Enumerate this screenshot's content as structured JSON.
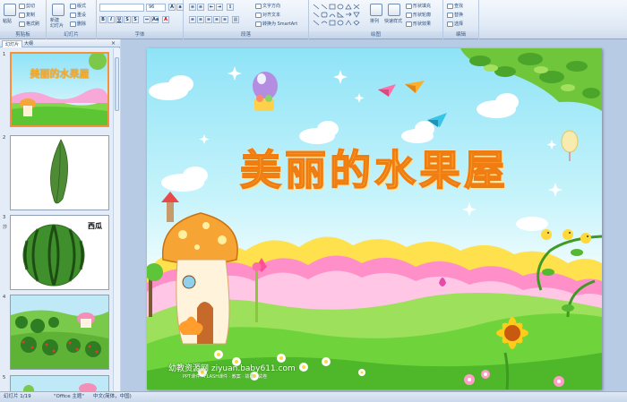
{
  "ribbon": {
    "clipboard": {
      "label": "剪贴板",
      "paste": "粘贴",
      "cut": "剪切",
      "copy": "复制",
      "format_painter": "格式刷"
    },
    "slides": {
      "label": "幻灯片",
      "new_slide": "新建\n幻灯片",
      "layout": "版式",
      "reset": "重设",
      "delete": "删除"
    },
    "font": {
      "label": "字体",
      "font_size": "96"
    },
    "paragraph": {
      "label": "段落",
      "text_direction": "文字方向",
      "align_text": "对齐文本",
      "smartart": "转换为 SmartArt"
    },
    "drawing": {
      "label": "绘图",
      "arrange": "排列",
      "quick_styles": "快速样式",
      "shape_fill": "形状填充",
      "shape_outline": "形状轮廓",
      "shape_effects": "形状效果"
    },
    "editing": {
      "label": "编辑",
      "find": "查找",
      "replace": "替换",
      "select": "选择"
    }
  },
  "panel": {
    "tab_slides": "幻灯片",
    "tab_outline": "大纲",
    "close": "×",
    "thumbnails": [
      {
        "number": "1",
        "star": ""
      },
      {
        "number": "2",
        "star": ""
      },
      {
        "number": "3",
        "star": "莎"
      },
      {
        "number": "4",
        "star": ""
      },
      {
        "number": "5",
        "star": ""
      }
    ],
    "thumb3_label": "西瓜",
    "thumb1_title": "美丽的水果屋"
  },
  "slide": {
    "title": "美丽的水果屋",
    "watermark_line1": "幼教资源网 ziyuan.baby611.com",
    "watermark_line2": "PPT课件 · FLASH课件 · 教案 · 故事 · 试卷"
  },
  "status": {
    "slide_info": "幻灯片 1/19",
    "theme": "\"Office 主题\"",
    "language": "中文(简体，中国)"
  },
  "colors": {
    "ribbon_bg": "#dfe9f5",
    "selection": "#f29437",
    "title_fill": "#f9b233",
    "sky": "#8fe3f7",
    "grass": "#6fd33b"
  }
}
